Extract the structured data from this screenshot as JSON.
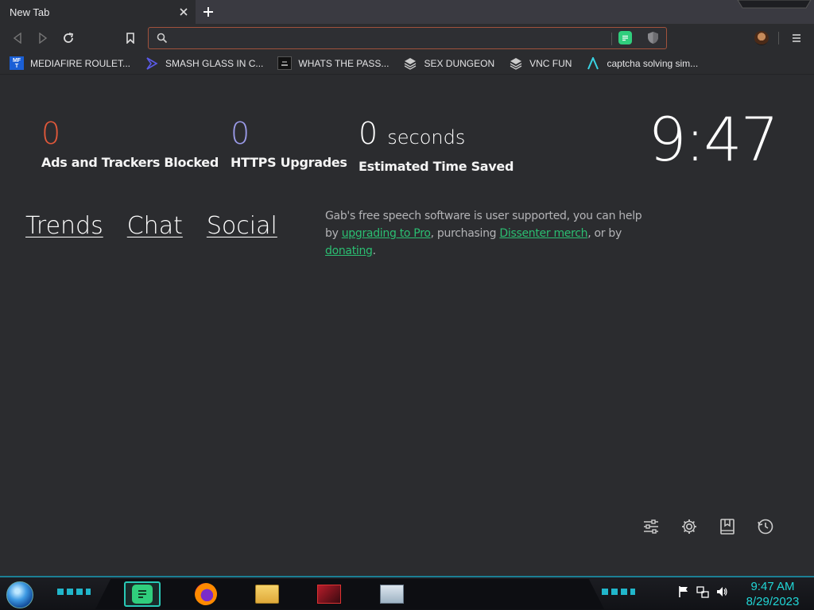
{
  "browser": {
    "tab_title": "New Tab",
    "url_value": "",
    "url_placeholder": ""
  },
  "bookmarks": [
    {
      "label": "MEDIAFIRE ROULET...",
      "icon": "mediafire-icon"
    },
    {
      "label": "SMASH GLASS IN C...",
      "icon": "sigma-icon"
    },
    {
      "label": "WHATS THE PASS...",
      "icon": "terminal-icon"
    },
    {
      "label": "SEX DUNGEON",
      "icon": "tor-icon"
    },
    {
      "label": "VNC FUN",
      "icon": "tor-icon"
    },
    {
      "label": "captcha solving sim...",
      "icon": "a-logo-icon"
    }
  ],
  "stats": {
    "ads_blocked": {
      "value": "0",
      "label": "Ads and Trackers Blocked",
      "color": "#e0583a"
    },
    "https_upgrades": {
      "value": "0",
      "label": "HTTPS Upgrades",
      "color": "#9a9ae8"
    },
    "time_saved": {
      "value": "0",
      "unit": "seconds",
      "label": "Estimated Time Saved"
    }
  },
  "clock": "9:47",
  "links": {
    "trends": "Trends",
    "chat": "Chat",
    "social": "Social"
  },
  "support": {
    "prefix": "Gab's free speech software is user supported, you can help by ",
    "link_pro": "upgrading to Pro",
    "mid": ", purchasing ",
    "link_merch": "Dissenter merch",
    "mid2": ", or by ",
    "link_donate": "donating",
    "suffix": "."
  },
  "bottom_icons": [
    "customize-icon",
    "settings-icon",
    "bookmarks-icon",
    "history-icon"
  ],
  "taskbar": {
    "time": "9:47 AM",
    "date": "8/29/2023",
    "apps": [
      "gab-chat-icon",
      "firefox-icon",
      "file-explorer-icon",
      "media-app-icon",
      "task-manager-icon"
    ]
  },
  "colors": {
    "accent_green": "#2bbf72",
    "url_border": "#a1523c",
    "taskbar_cyan": "#21d6d6"
  }
}
